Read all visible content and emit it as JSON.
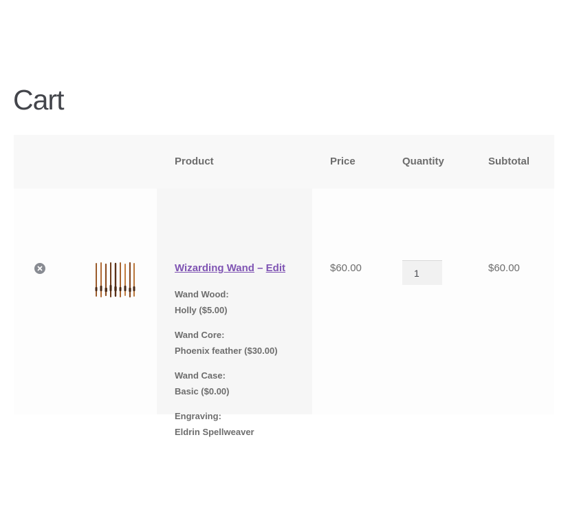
{
  "page": {
    "title": "Cart"
  },
  "table": {
    "headers": {
      "product": "Product",
      "price": "Price",
      "quantity": "Quantity",
      "subtotal": "Subtotal"
    }
  },
  "cart_item": {
    "remove_icon": "remove-circle-x-icon",
    "thumbnail_icon": "wands-thumbnail",
    "name": "Wizarding Wand",
    "separator": "–",
    "edit_label": "Edit",
    "meta": [
      {
        "label": "Wand Wood:",
        "value": "Holly ($5.00)"
      },
      {
        "label": "Wand Core:",
        "value": "Phoenix feather ($30.00)"
      },
      {
        "label": "Wand Case:",
        "value": "Basic ($0.00)"
      },
      {
        "label": "Engraving:",
        "value": "Eldrin Spellweaver"
      }
    ],
    "price": "$60.00",
    "quantity": "1",
    "subtotal": "$60.00"
  },
  "colors": {
    "link": "#7f54b3",
    "text": "#6d6d6d",
    "title": "#43454b",
    "header_bg": "#f8f8f8",
    "product_cell_bg": "#f6f6f6"
  }
}
